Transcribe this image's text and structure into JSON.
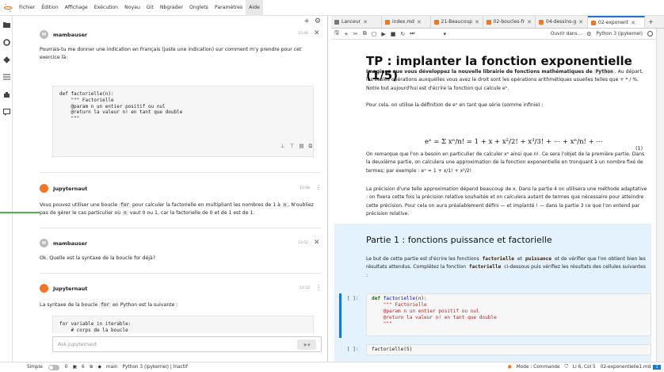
{
  "menubar": {
    "items": [
      "Fichier",
      "Édition",
      "Affichage",
      "Exécution",
      "Noyau",
      "Git",
      "Nbgrader",
      "Onglets",
      "Paramètres",
      "Aide"
    ]
  },
  "chat": {
    "messages": [
      {
        "author": "mambauser",
        "avatar": "M",
        "time": "13:46",
        "text": "Pourrais-tu me donner une indication en Français (juste une indication) sur comment m'y prendre pour cet exercice là:",
        "code": "def factorielle(n):\n    \"\"\" Factorielle\n    @param n un entier positif ou nul\n    @return la valeur n! en tant que double\n    \"\"\""
      },
      {
        "author": "Jupyternaut",
        "time": "13:46",
        "text_parts": [
          "Vous pouvez utiliser une boucle ",
          "for",
          " pour calculer la factorielle en multipliant les nombres de 1 à ",
          "n",
          ". N'oubliez pas de gérer le cas particulier où ",
          "n",
          " vaut 0 ou 1, car la factorielle de 0 et de 1 est de 1."
        ]
      },
      {
        "author": "mambauser",
        "avatar": "M",
        "time": "13:52",
        "text": "Ok. Quelle est la syntaxe de la boucle for déjà?"
      },
      {
        "author": "Jupyternaut",
        "time": "13:52",
        "text_parts": [
          "La syntaxe de la boucle ",
          "for",
          " en Python est la suivante :"
        ],
        "code": "for variable in iterable:\n    # corps de la boucle"
      }
    ],
    "input_placeholder": "Ask Jupyternaut"
  },
  "tabs": [
    {
      "label": "Lanceur",
      "icon": "launcher-icon"
    },
    {
      "label": "index.md",
      "icon": "markdown-icon"
    },
    {
      "label": "21-Beaucoup",
      "icon": "notebook-icon"
    },
    {
      "label": "02-boucles-fr",
      "icon": "notebook-icon"
    },
    {
      "label": "04-dessins-g",
      "icon": "notebook-icon"
    },
    {
      "label": "02-exponent",
      "icon": "notebook-icon",
      "active": true
    }
  ],
  "toolbar": {
    "open_in": "Ouvrir dans...",
    "kernel": "Python 3 (ipykernel)"
  },
  "notebook": {
    "title": "TP : implanter la fonction exponentielle (1/5)",
    "p1_bold": "Imaginez que vous développez la nouvelle librairie de fonctions mathématiques de",
    "p1_mono": "Python",
    "p1_rest": ". Au départ, les seules opérations auxquelles vous avez le droit sont les opérations arithmétiques usuelles telles que + * / %. Notre but aujourd'hui est d'écrire la fonction qui calcule eˣ.",
    "p2": "Pour cela, on utilise la définition de eˣ en tant que série (somme infinie) :",
    "formula": "eˣ = Σ xⁿ/n! = 1 + x + x²/2! + x³/3! + ⋯ + xⁿ/n! + ⋯",
    "formula_num": "(1)",
    "p3": "On remarque que l'on a besoin en particulier de calculer xⁿ ainsi que n!. Ce sera l'objet de la première partie. Dans la deuxième partie, on calculera une approximation de la fonction exponentielle en tronquant à un nombre fixé de termes; par exemple : eˣ ≃ 1 + x/1! + x²/2!",
    "p4": "La précision d'une telle approximation dépend beaucoup de x. Dans la partie 4 on utilisera une méthode adaptative : on fixera cette fois la précision relative souhaitée et on calculera autant de termes que nécessaire pour atteindre cette précision. Pour cela on aura préalablement défini — et implanté ! — dans la partie 3 ce que l'on entend par précision relative.",
    "h2": "Partie 1 : fonctions puissance et factorielle",
    "p5_parts": [
      "Le but de cette partie est d'écrire les fonctions ",
      "factorielle",
      " et ",
      "puissance",
      " et de vérifier que l'on obtient bien les résultats attendus. Complétez la fonction ",
      "factorielle",
      " ci-dessous puis vérifiez les résultats des cellules suivantes :"
    ],
    "prompt": "[ ]:",
    "code1_def": "def",
    "code1_fn": "factorielle",
    "code1_sig": "(n):",
    "code1_doc": "    \"\"\" Factorielle\n    @param n un entier positif ou nul\n    @return la valeur n! en tant que double\n    \"\"\"",
    "code2": "factorielle(5)"
  },
  "statusbar": {
    "mode_label": "Simple",
    "count1": "0",
    "count2": "6",
    "branch": "main",
    "kernel": "Python 3 (ipykernel) | Inactif",
    "mode": "Mode : Commande",
    "position": "Li 6, Col 5",
    "file": "02-exponentielle1.md",
    "badge": "1"
  }
}
